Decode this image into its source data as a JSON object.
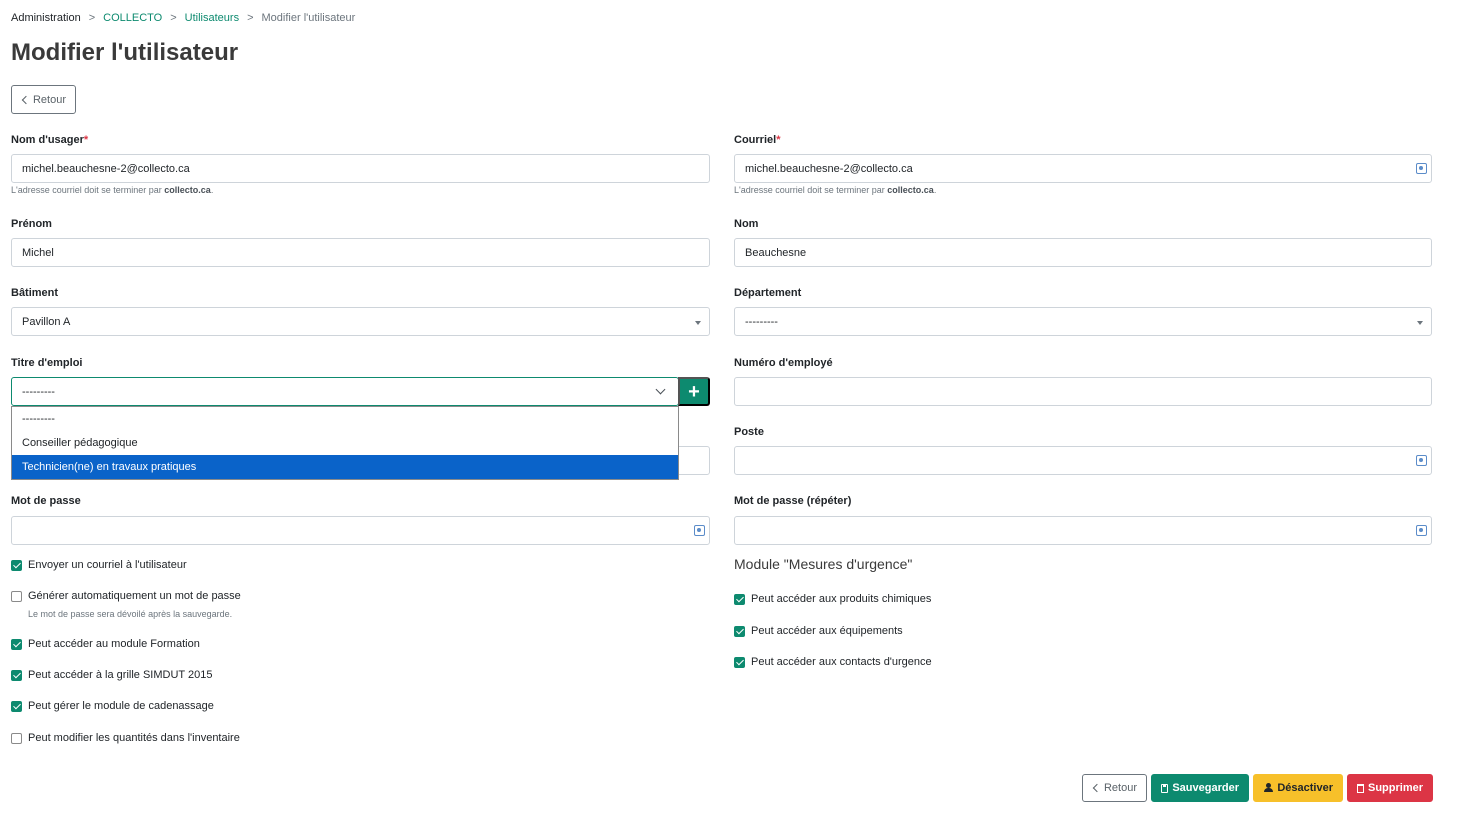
{
  "breadcrumb": {
    "items": [
      "Administration",
      "COLLECTO",
      "Utilisateurs",
      "Modifier l'utilisateur"
    ],
    "separator": ">"
  },
  "page_title": "Modifier l'utilisateur",
  "back_label": "Retour",
  "fields": {
    "username": {
      "label": "Nom d'usager",
      "required_mark": "*",
      "value": "michel.beauchesne-2@collecto.ca",
      "help_prefix": "L'adresse courriel doit se terminer par ",
      "help_domain": "collecto.ca",
      "help_suffix": "."
    },
    "email": {
      "label": "Courriel",
      "required_mark": "*",
      "value": "michel.beauchesne-2@collecto.ca",
      "help_prefix": "L'adresse courriel doit se terminer par ",
      "help_domain": "collecto.ca",
      "help_suffix": "."
    },
    "first_name": {
      "label": "Prénom",
      "value": "Michel"
    },
    "last_name": {
      "label": "Nom",
      "value": "Beauchesne"
    },
    "building": {
      "label": "Bâtiment",
      "value": "Pavillon A"
    },
    "department": {
      "label": "Département",
      "value": "---------"
    },
    "job_title": {
      "label": "Titre d'emploi",
      "value": "---------",
      "add_label": "+"
    },
    "employee_number": {
      "label": "Numéro d'employé",
      "value": ""
    },
    "position": {
      "label": "Poste",
      "value": ""
    },
    "password": {
      "label": "Mot de passe",
      "value": ""
    },
    "password_repeat": {
      "label": "Mot de passe (répéter)",
      "value": ""
    }
  },
  "job_title_options": [
    "---------",
    "Conseiller pédagogique",
    "Technicien(ne) en travaux pratiques"
  ],
  "checkboxes_left": [
    {
      "label": "Envoyer un courriel à l'utilisateur",
      "checked": true
    },
    {
      "label": "Générer automatiquement un mot de passe",
      "checked": false,
      "help": "Le mot de passe sera dévoilé après la sauvegarde."
    },
    {
      "label": "Peut accéder au module Formation",
      "checked": true
    },
    {
      "label": "Peut accéder à la grille SIMDUT 2015",
      "checked": true
    },
    {
      "label": "Peut gérer le module de cadenassage",
      "checked": true
    },
    {
      "label": "Peut modifier les quantités dans l'inventaire",
      "checked": false
    }
  ],
  "module_title": "Module \"Mesures d'urgence\"",
  "checkboxes_right": [
    {
      "label": "Peut accéder aux produits chimiques",
      "checked": true
    },
    {
      "label": "Peut accéder aux équipements",
      "checked": true
    },
    {
      "label": "Peut accéder aux contacts d'urgence",
      "checked": true
    }
  ],
  "footer": {
    "back": "Retour",
    "save": "Sauvegarder",
    "deactivate": "Désactiver",
    "delete": "Supprimer"
  },
  "colors": {
    "primary": "#0d8a6f",
    "warning": "#f7c02a",
    "danger": "#dc3545",
    "selected_option": "#0a63c9"
  }
}
